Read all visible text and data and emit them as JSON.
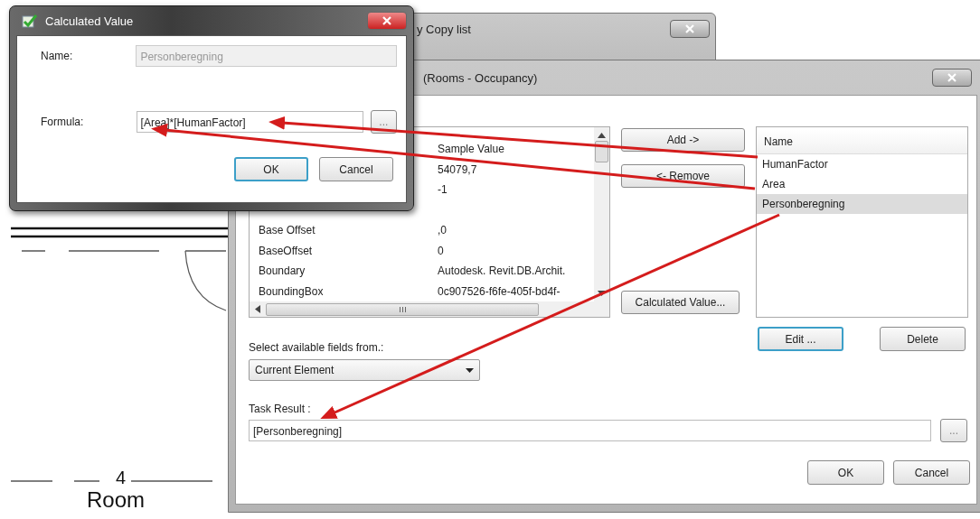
{
  "background": {
    "room_number": "4",
    "room_label": "Room"
  },
  "back_window": {
    "title": "y Copy list"
  },
  "main_window": {
    "title": "(Rooms - Occupancy)",
    "available_fields": {
      "column": "Sample Value",
      "value_only_rows": [
        {
          "value": "54079,7"
        },
        {
          "value": "-1"
        }
      ],
      "rows": [
        {
          "name": "Base Offset",
          "value": ",0"
        },
        {
          "name": "BaseOffset",
          "value": "0"
        },
        {
          "name": "Boundary",
          "value": "Autodesk. Revit.DB.Archit."
        },
        {
          "name": "BoundingBox",
          "value": "0c907526-f6fe-405f-bd4f-"
        }
      ]
    },
    "middle_buttons": [
      {
        "label": "Add ->",
        "focused": false
      },
      {
        "label": "<- Remove",
        "focused": false
      }
    ],
    "calculated_value_button": {
      "label": "Calculated Value...",
      "focused": false
    },
    "selected_fields": {
      "header": "Name",
      "items": [
        {
          "label": "HumanFactor",
          "selected": false
        },
        {
          "label": "Area",
          "selected": false
        },
        {
          "label": "Personberegning",
          "selected": true
        }
      ]
    },
    "list_buttons": [
      {
        "label": "Edit ...",
        "focused": true
      },
      {
        "label": "Delete",
        "focused": false
      }
    ],
    "source_label": "Select available fields from.:",
    "source_dropdown": "Current Element",
    "task_result_label": "Task Result :",
    "task_result_value": "[Personberegning]",
    "browse_button": "...",
    "footer_buttons": [
      {
        "label": "OK",
        "focused": false
      },
      {
        "label": "Cancel",
        "focused": false
      }
    ]
  },
  "calc_dialog": {
    "title": "Calculated Value",
    "name_label": "Name:",
    "name_value": "Personberegning",
    "name_disabled": true,
    "formula_label": "Formula:",
    "formula_value": "[Area]*[HumanFactor]",
    "browse_button": "...",
    "buttons": [
      {
        "label": "OK",
        "focused": true
      },
      {
        "label": "Cancel",
        "focused": false
      }
    ]
  }
}
